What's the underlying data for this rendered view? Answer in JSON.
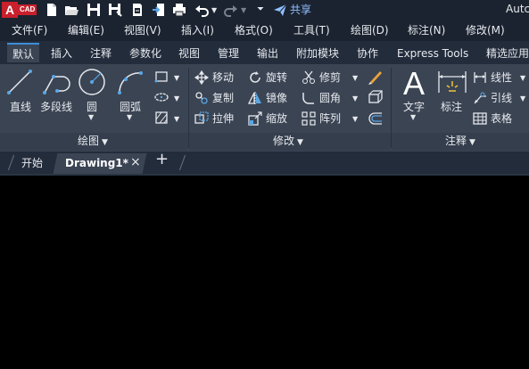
{
  "app": {
    "logo_letter": "A",
    "logo_badge": "CAD",
    "share_label": "共享",
    "window_title": "Autc"
  },
  "menu": [
    "文件(F)",
    "编辑(E)",
    "视图(V)",
    "插入(I)",
    "格式(O)",
    "工具(T)",
    "绘图(D)",
    "标注(N)",
    "修改(M)"
  ],
  "ribbon_tabs": [
    "默认",
    "插入",
    "注释",
    "参数化",
    "视图",
    "管理",
    "输出",
    "附加模块",
    "协作",
    "Express Tools",
    "精选应用"
  ],
  "panels": {
    "draw": {
      "title": "绘图",
      "line": "直线",
      "polyline": "多段线",
      "circle": "圆",
      "arc": "圆弧"
    },
    "modify": {
      "title": "修改",
      "move": "移动",
      "rotate": "旋转",
      "trim": "修剪",
      "copy": "复制",
      "mirror": "镜像",
      "fillet": "圆角",
      "stretch": "拉伸",
      "scale": "缩放",
      "array": "阵列"
    },
    "annotation": {
      "title": "注释",
      "text": "文字",
      "dimension": "标注",
      "linear": "线性",
      "leader": "引线",
      "table": "表格"
    }
  },
  "doc_tabs": {
    "start": "开始",
    "drawing": "Drawing1*",
    "close": "×",
    "new": "+"
  },
  "colors": {
    "accent": "#3c8fd6",
    "icon_blue": "#5aa7e6",
    "logo_red": "#c8202c"
  }
}
